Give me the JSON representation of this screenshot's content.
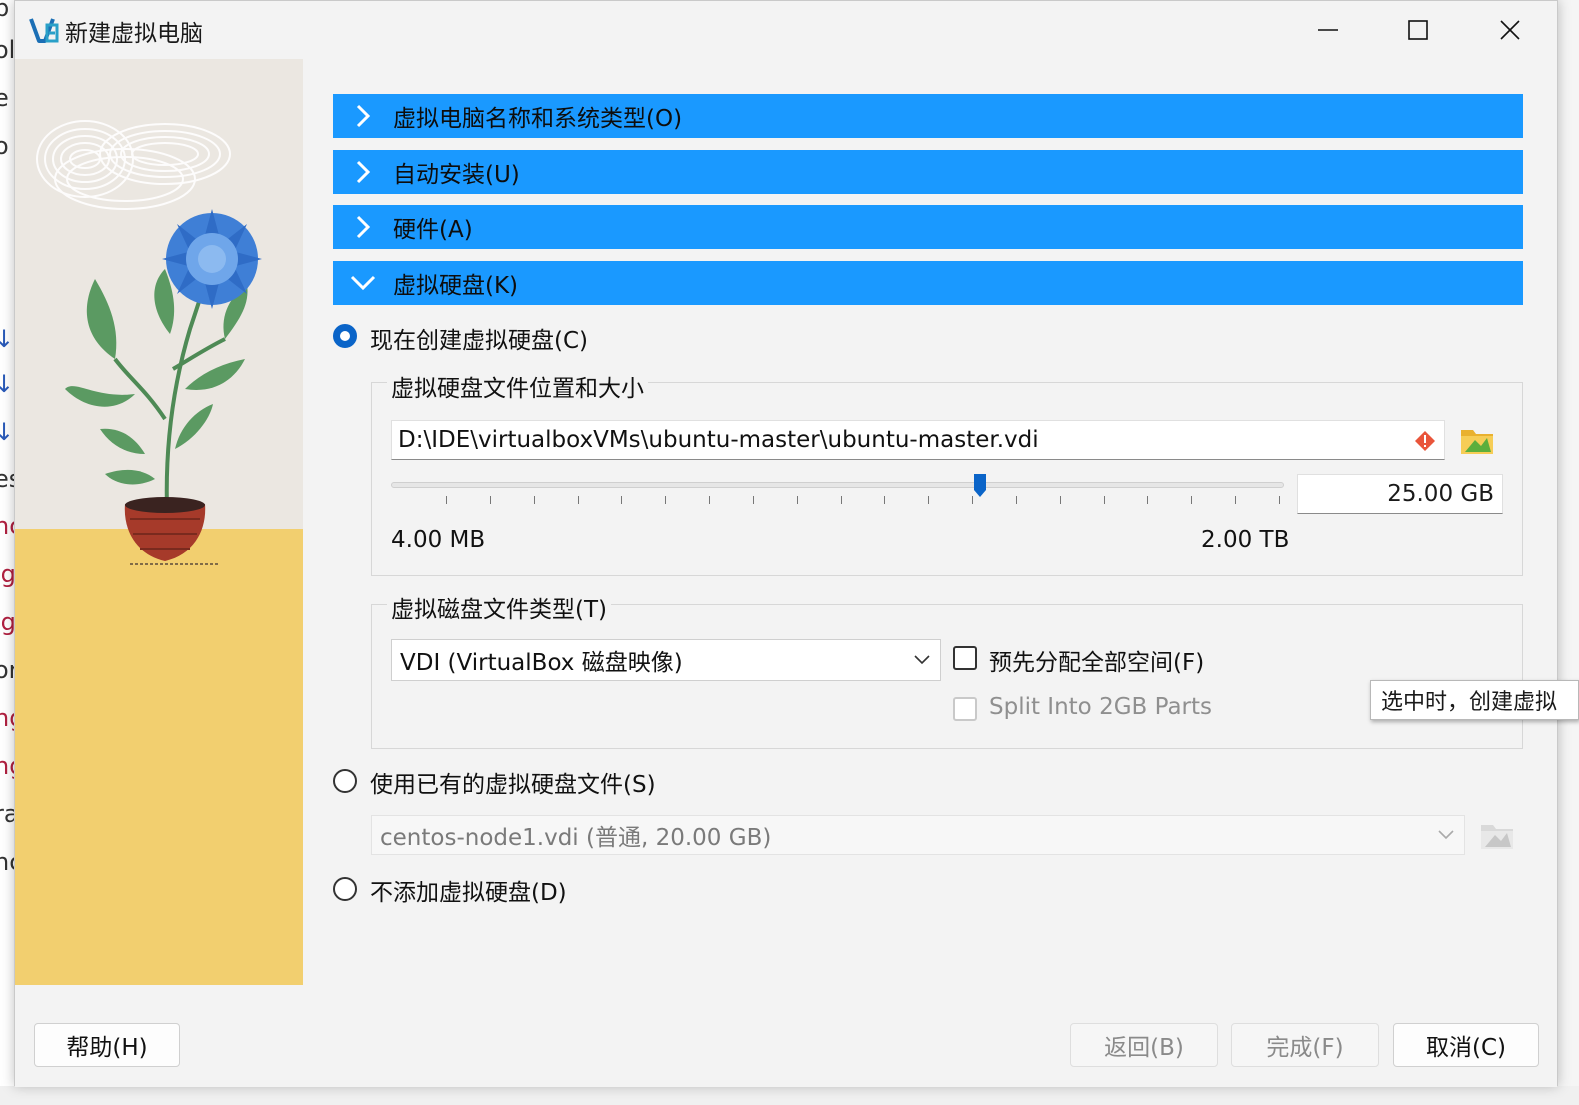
{
  "window": {
    "title": "新建虚拟电脑"
  },
  "sections": [
    {
      "label": "虚拟电脑名称和系统类型(O)",
      "expanded": false
    },
    {
      "label": "自动安装(U)",
      "expanded": false
    },
    {
      "label": "硬件(A)",
      "expanded": false
    },
    {
      "label": "虚拟硬盘(K)",
      "expanded": true
    }
  ],
  "disk": {
    "create_now_label": "现在创建虚拟硬盘(C)",
    "location_group_title": "虚拟硬盘文件位置和大小",
    "path_value": "D:\\IDE\\virtualboxVMs\\ubuntu-master\\ubuntu-master.vdi",
    "size_value": "25.00 GB",
    "size_fraction": 0.66,
    "min_label": "4.00 MB",
    "max_label": "2.00 TB",
    "type_group_title": "虚拟磁盘文件类型(T)",
    "type_selected": "VDI (VirtualBox 磁盘映像)",
    "preallocate_label": "预先分配全部空间(F)",
    "split_label": "Split Into 2GB Parts",
    "tooltip_text": "选中时，创建虚拟",
    "use_existing_label": "使用已有的虚拟硬盘文件(S)",
    "existing_selected": "centos-node1.vdi (普通, 20.00 GB)",
    "no_disk_label": "不添加虚拟硬盘(D)"
  },
  "buttons": {
    "help": "帮助(H)",
    "back": "返回(B)",
    "finish": "完成(F)",
    "cancel": "取消(C)"
  },
  "background_edge": [
    "b",
    "ol",
    "e",
    "o",
    "",
    "",
    "",
    "↓",
    "↓",
    "↓",
    "es",
    "nc",
    "ig",
    "ig",
    "or",
    "ng",
    "ng",
    "ra",
    "nc"
  ],
  "colors": {
    "accent": "#1a99ff",
    "radio_on": "#0a64c8",
    "floor": "#f2cf6f",
    "wall": "#ebe7e1"
  }
}
